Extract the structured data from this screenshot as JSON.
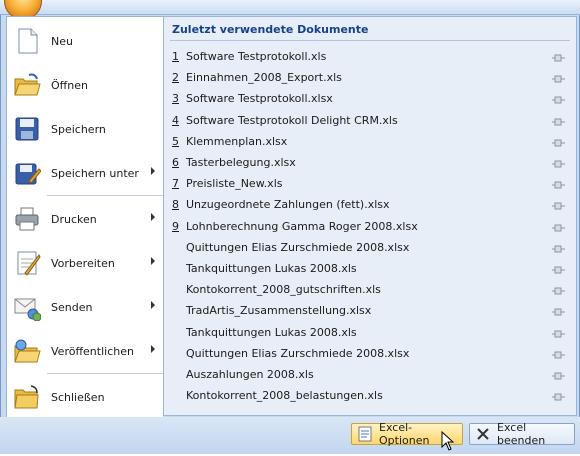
{
  "menu": {
    "items": [
      {
        "label": "Neu",
        "icon": "new-document-icon",
        "has_submenu": false
      },
      {
        "label": "Öffnen",
        "icon": "open-folder-icon",
        "has_submenu": false
      },
      {
        "label": "Speichern",
        "icon": "save-disk-icon",
        "has_submenu": false
      },
      {
        "label": "Speichern unter",
        "icon": "save-as-icon",
        "has_submenu": true
      },
      {
        "label": "Drucken",
        "icon": "printer-icon",
        "has_submenu": true
      },
      {
        "label": "Vorbereiten",
        "icon": "prepare-icon",
        "has_submenu": true
      },
      {
        "label": "Senden",
        "icon": "send-mail-icon",
        "has_submenu": true
      },
      {
        "label": "Veröffentlichen",
        "icon": "publish-folder-icon",
        "has_submenu": true
      },
      {
        "label": "Schließen",
        "icon": "close-folder-icon",
        "has_submenu": false
      }
    ]
  },
  "recent": {
    "header": "Zuletzt verwendete Dokumente",
    "documents": [
      {
        "num": "1",
        "name": "Software Testprotokoll.xls"
      },
      {
        "num": "2",
        "name": "Einnahmen_2008_Export.xls"
      },
      {
        "num": "3",
        "name": "Software Testprotokoll.xlsx"
      },
      {
        "num": "4",
        "name": "Software Testprotokoll Delight CRM.xls"
      },
      {
        "num": "5",
        "name": "Klemmenplan.xlsx"
      },
      {
        "num": "6",
        "name": "Tasterbelegung.xlsx"
      },
      {
        "num": "7",
        "name": "Preisliste_New.xls"
      },
      {
        "num": "8",
        "name": "Unzugeordnete Zahlungen (fett).xlsx"
      },
      {
        "num": "9",
        "name": "Lohnberechnung Gamma Roger 2008.xlsx"
      },
      {
        "num": "",
        "name": "Quittungen Elias Zurschmiede 2008.xlsx"
      },
      {
        "num": "",
        "name": "Tankquittungen Lukas 2008.xls"
      },
      {
        "num": "",
        "name": "Kontokorrent_2008_gutschriften.xls"
      },
      {
        "num": "",
        "name": "TradArtis_Zusammenstellung.xlsx"
      },
      {
        "num": "",
        "name": "Tankquittungen Lukas 2008.xls"
      },
      {
        "num": "",
        "name": "Quittungen Elias Zurschmiede 2008.xlsx"
      },
      {
        "num": "",
        "name": "Auszahlungen 2008.xls"
      },
      {
        "num": "",
        "name": "Kontokorrent_2008_belastungen.xls"
      }
    ]
  },
  "footer": {
    "options_label": "Excel-Optionen",
    "exit_label": "Excel beenden"
  }
}
